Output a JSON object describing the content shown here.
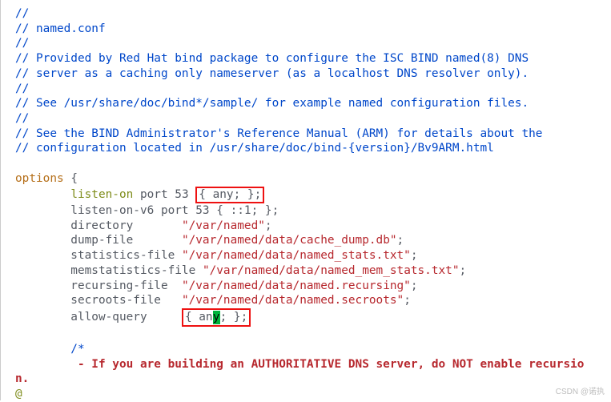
{
  "comments": {
    "l1": "//",
    "l2": "// named.conf",
    "l3": "//",
    "l4": "// Provided by Red Hat bind package to configure the ISC BIND named(8) DNS",
    "l5": "// server as a caching only nameserver (as a localhost DNS resolver only).",
    "l6": "//",
    "l7": "// See /usr/share/doc/bind*/sample/ for example named configuration files.",
    "l8": "//",
    "l9": "// See the BIND Administrator's Reference Manual (ARM) for details about the",
    "l10": "// configuration located in /usr/share/doc/bind-{version}/Bv9ARM.html"
  },
  "code": {
    "options": "options",
    "obrace": " {",
    "indent1": "        ",
    "listen_on": "listen-on",
    "listen_on_rest": " port 53 ",
    "box1_text": "{ any; };",
    "listen_v6": "        listen-on-v6 port 53 { ::1; };",
    "directory": "        directory       ",
    "directory_path": "\"/var/named\"",
    "directory_semi": ";",
    "dump_file": "        dump-file       ",
    "dump_file_path": "\"/var/named/data/cache_dump.db\"",
    "dump_file_semi": ";",
    "stats": "        statistics-file ",
    "stats_path": "\"/var/named/data/named_stats.txt\"",
    "stats_semi": ";",
    "memstats": "        memstatistics-file ",
    "memstats_path": "\"/var/named/data/named_mem_stats.txt\"",
    "memstats_semi": ";",
    "recursing": "        recursing-file  ",
    "recursing_path": "\"/var/named/data/named.recursing\"",
    "recursing_semi": ";",
    "secroots": "        secroots-file   ",
    "secroots_path": "\"/var/named/data/named.secroots\"",
    "secroots_semi": ";",
    "allow_query": "        allow-query     ",
    "box2_pre": "{ an",
    "box2_cursor": "y",
    "box2_post": "; };",
    "blk_open": "        /*",
    "blk_line": "         - If you are building an AUTHORITATIVE DNS server, do NOT enable recursio",
    "blk_wrap": "n.",
    "atline": "@"
  },
  "watermark": "CSDN @诺执"
}
